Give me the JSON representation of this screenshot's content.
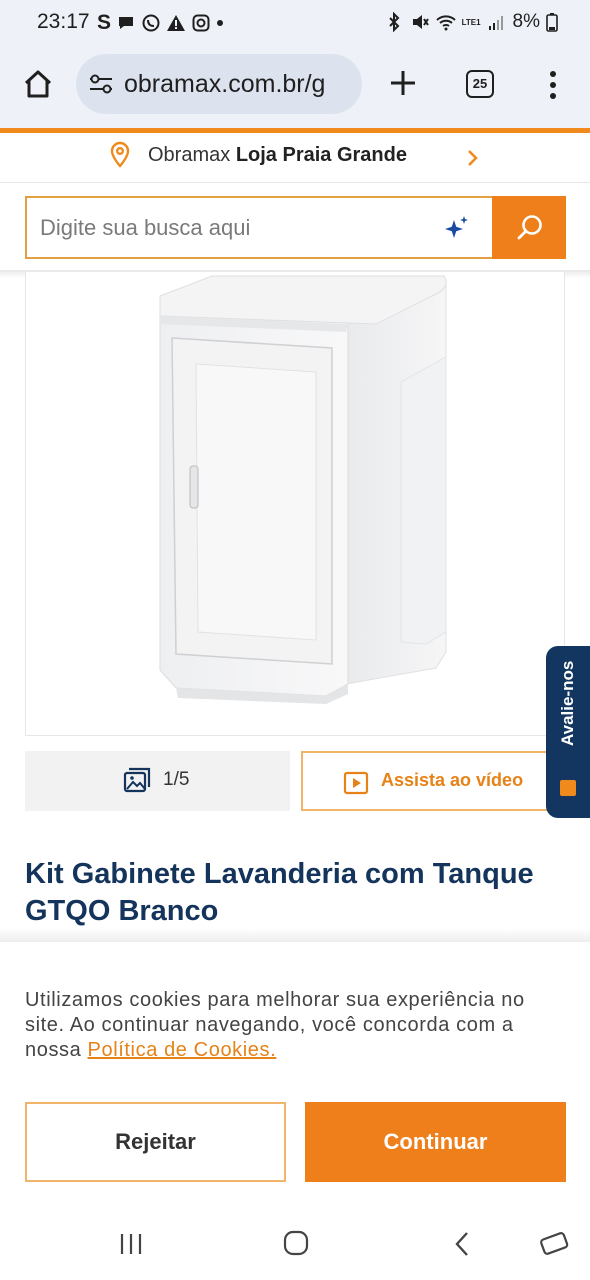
{
  "status_bar": {
    "time": "23:17",
    "carrier_letter": "S",
    "battery": "8%",
    "network": "LTE1"
  },
  "browser": {
    "url": "obramax.com.br/g",
    "tab_count": "25"
  },
  "store": {
    "prefix": "Obramax",
    "name": "Loja Praia Grande"
  },
  "search": {
    "placeholder": "Digite sua busca aqui"
  },
  "gallery": {
    "counter": "1/5",
    "video_label": "Assista ao vídeo"
  },
  "feedback": {
    "label": "Avalie-nos"
  },
  "product": {
    "title": "Kit Gabinete Lavanderia com Tanque GTQO Branco"
  },
  "cookies": {
    "text": "Utilizamos cookies para melhorar sua experiência no site. Ao continuar navegando, você concorda com a nossa ",
    "link_label": "Política de Cookies.",
    "reject_label": "Rejeitar",
    "accept_label": "Continuar"
  },
  "colors": {
    "brand_orange": "#ef7f1a",
    "brand_navy": "#14345c",
    "feedback_navy": "#12365f"
  }
}
